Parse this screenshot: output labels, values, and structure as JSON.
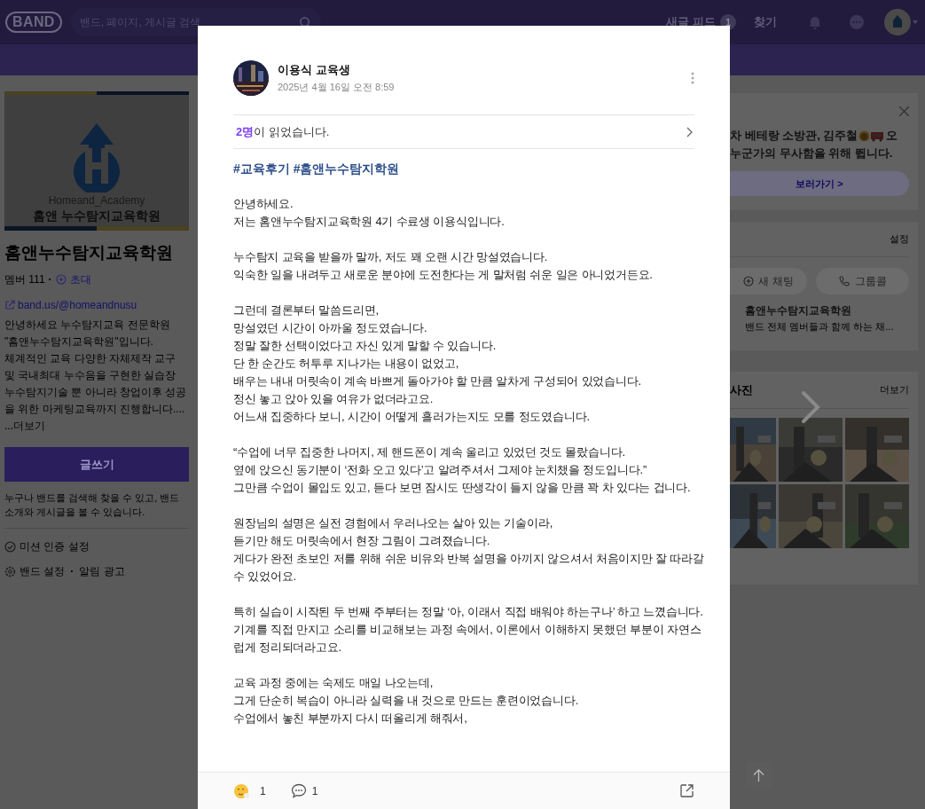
{
  "header": {
    "logo": "BAND",
    "search_placeholder": "밴드, 페이지, 게시글 검색",
    "feed": {
      "label": "새글 피드",
      "badge": "1"
    },
    "find": "찾기"
  },
  "band": {
    "logo_caption": "Homeand_Academy",
    "logo_name": "홈앤 누수탐지교육학원",
    "name": "홈앤누수탐지교육학원",
    "members": "멤버 111",
    "separator": "·",
    "invite": "초대",
    "link": "band.us/@homeandnusu",
    "description": [
      "안녕하세요 누수탐지교육 전문학원",
      "\"홈앤누수탐지교육학원\"입니다.",
      "체계적인 교육 다양한 자체제작 교구 및 국내최대 누수음을 구현한 실습장 누수탐지기술 뿐 아니라 창업이후 성공을 위한 마케팅교육까지 진행합니다...."
    ],
    "more": "...더보기",
    "write_button": "글쓰기",
    "notice": "누구나 밴드를 검색해 찾을 수 있고, 밴드 소개와 게시글을 볼 수 있습니다.",
    "mission": "미션 인증 설정",
    "settings": "밴드 설정",
    "ads": "알림 광고"
  },
  "promo": {
    "text_before_icons": "차 베테랑 소방관, 김주철",
    "text_after_icons": "오",
    "line_2": "누군가의 무사함을 위해 뜁니다.",
    "button": "보러가기 >"
  },
  "chat": {
    "settings": "설정",
    "new_chat": "새 채팅",
    "group_call": "그룹콜",
    "item": {
      "name": "홈앤누수탐지교육학원",
      "preview": "밴드 전체 멤버들과 함께 하는 채..."
    }
  },
  "photos": {
    "title": "사진",
    "more": "더보기"
  },
  "post": {
    "author": "이용식 교육생",
    "date": "2025년 4월 16일 오전 8:59",
    "readers": "**2명**이 읽었습니다.",
    "hashtags": "#교육후기 #홈앤누수탐지학원",
    "paragraphs": [
      [
        "안녕하세요.",
        "저는 홈앤누수탐지교육학원 4기 수료생 이용식입니다."
      ],
      [
        "누수탐지 교육을 받을까 말까, 저도 꽤 오랜 시간 망설였습니다.",
        "익숙한 일을 내려두고 새로운 분야에 도전한다는 게 말처럼 쉬운 일은 아니었거든요."
      ],
      [
        "그런데 결론부터 말씀드리면,",
        "망설였던 시간이 아까울 정도였습니다.",
        "정말 잘한 선택이었다고 자신 있게 말할 수 있습니다.",
        "단 한 순간도 허투루 지나가는 내용이 없었고,",
        "배우는 내내 머릿속이 계속 바쁘게 돌아가야 할 만큼 알차게 구성되어 있었습니다.",
        "정신 놓고 앉아 있을 여유가 없더라고요.",
        "어느새 집중하다 보니, 시간이 어떻게 흘러가는지도 모를 정도였습니다."
      ],
      [
        "“수업에 너무 집중한 나머지, 제 핸드폰이 계속 울리고 있었던 것도 몰랐습니다.",
        "옆에 앉으신 동기분이 ‘전화 오고 있다’고 알려주셔서 그제야 눈치챘을 정도입니다.”",
        "그만큼 수업이 몰입도 있고, 듣다 보면 잠시도 딴생각이 들지 않을 만큼 꽉 차 있다는 겁니다."
      ],
      [
        "원장님의 설명은 실전 경험에서 우러나오는 살아 있는 기술이라,",
        "듣기만 해도 머릿속에서 현장 그림이 그려졌습니다.",
        "게다가 완전 초보인 저를 위해 쉬운 비유와 반복 설명을 아끼지 않으셔서 처음이지만 잘 따라갈 수 있었어요."
      ],
      [
        "특히 실습이 시작된 두 번째 주부터는 정말 ‘아, 이래서 직접 배워야 하는구나’ 하고 느꼈습니다.",
        "기계를 직접 만지고 소리를 비교해보는 과정 속에서, 이론에서 이해하지 못했던 부분이 자연스럽게 정리되더라고요."
      ],
      [
        "교육 과정 중에는 숙제도 매일 나오는데,",
        "그게 단순히 복습이 아니라 실력을 내 것으로 만드는 훈련이었습니다.",
        "수업에서 놓친 부분까지 다시 떠올리게 해줘서,"
      ]
    ],
    "reactions": "1",
    "comments": "1"
  }
}
